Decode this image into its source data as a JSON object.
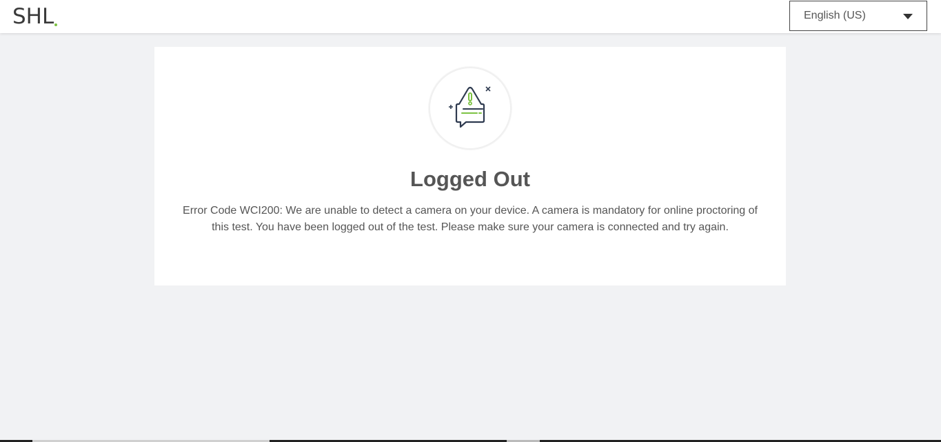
{
  "header": {
    "logo_text": "SHL",
    "language": {
      "selected": "English (US)"
    }
  },
  "card": {
    "icon": "warning-chat-bubble-icon",
    "title": "Logged Out",
    "message": "Error Code WCI200: We are unable to detect a camera on your device. A camera is mandatory for online proctoring of this test. You have been logged out of the test. Please make sure your camera is connected and try again."
  },
  "colors": {
    "brand_green": "#7cc242",
    "icon_navy": "#2e3a4f",
    "background": "#f1f2f4"
  }
}
